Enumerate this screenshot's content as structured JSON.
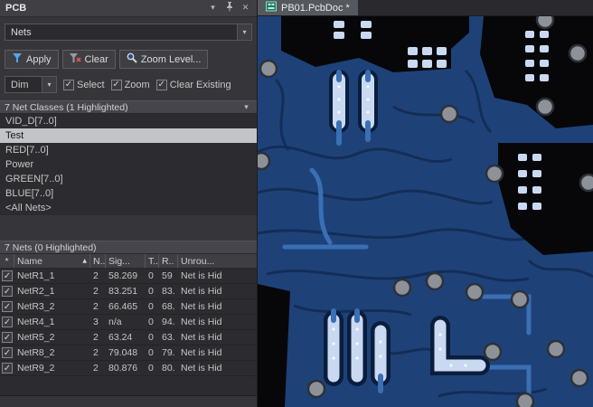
{
  "icons": {
    "check": "✓",
    "chevron_down": "▾",
    "close": "✕",
    "sort_asc": "▲"
  },
  "panel": {
    "title": "PCB",
    "mode": "Nets",
    "apply_label": "Apply",
    "clear_label": "Clear",
    "zoom_level_label": "Zoom Level...",
    "dim_label": "Dim",
    "options": {
      "select": "Select",
      "zoom": "Zoom",
      "clear_existing": "Clear Existing"
    },
    "classes": {
      "header": "7 Net Classes (1 Highlighted)",
      "items": [
        "VID_D[7..0]",
        "Test",
        "RED[7..0]",
        "Power",
        "GREEN[7..0]",
        "BLUE[7..0]",
        "<All Nets>"
      ],
      "selected": "Test"
    },
    "nets": {
      "header": "7 Nets (0 Highlighted)",
      "columns": {
        "check": "*",
        "name": "Name",
        "nodes": "N..",
        "signal": "Sig...",
        "t": "T...",
        "routed": "R..",
        "unrouted": "Unrou..."
      },
      "rows": [
        {
          "name": "NetR1_1",
          "nodes": "2",
          "signal": "58.269",
          "t": "0",
          "routed": "59",
          "unrouted": "Net is Hid"
        },
        {
          "name": "NetR2_1",
          "nodes": "2",
          "signal": "83.251",
          "t": "0",
          "routed": "83.",
          "unrouted": "Net is Hid"
        },
        {
          "name": "NetR3_2",
          "nodes": "2",
          "signal": "66.465",
          "t": "0",
          "routed": "68.",
          "unrouted": "Net is Hid"
        },
        {
          "name": "NetR4_1",
          "nodes": "3",
          "signal": "n/a",
          "t": "0",
          "routed": "94.",
          "unrouted": "Net is Hid"
        },
        {
          "name": "NetR5_2",
          "nodes": "2",
          "signal": "63.24",
          "t": "0",
          "routed": "63.",
          "unrouted": "Net is Hid"
        },
        {
          "name": "NetR8_2",
          "nodes": "2",
          "signal": "79.048",
          "t": "0",
          "routed": "79.",
          "unrouted": "Net is Hid"
        },
        {
          "name": "NetR9_2",
          "nodes": "2",
          "signal": "80.876",
          "t": "0",
          "routed": "80.",
          "unrouted": "Net is Hid"
        }
      ]
    }
  },
  "editor": {
    "tab": "PB01.PcbDoc *"
  },
  "colors": {
    "board_background": "#1e4278",
    "trace_blue": "#396fb4",
    "pad_light": "#c9d9f1",
    "via_gray": "#8e9298",
    "black_region": "#07070a",
    "selection_highlight": "#c2c4c8"
  }
}
